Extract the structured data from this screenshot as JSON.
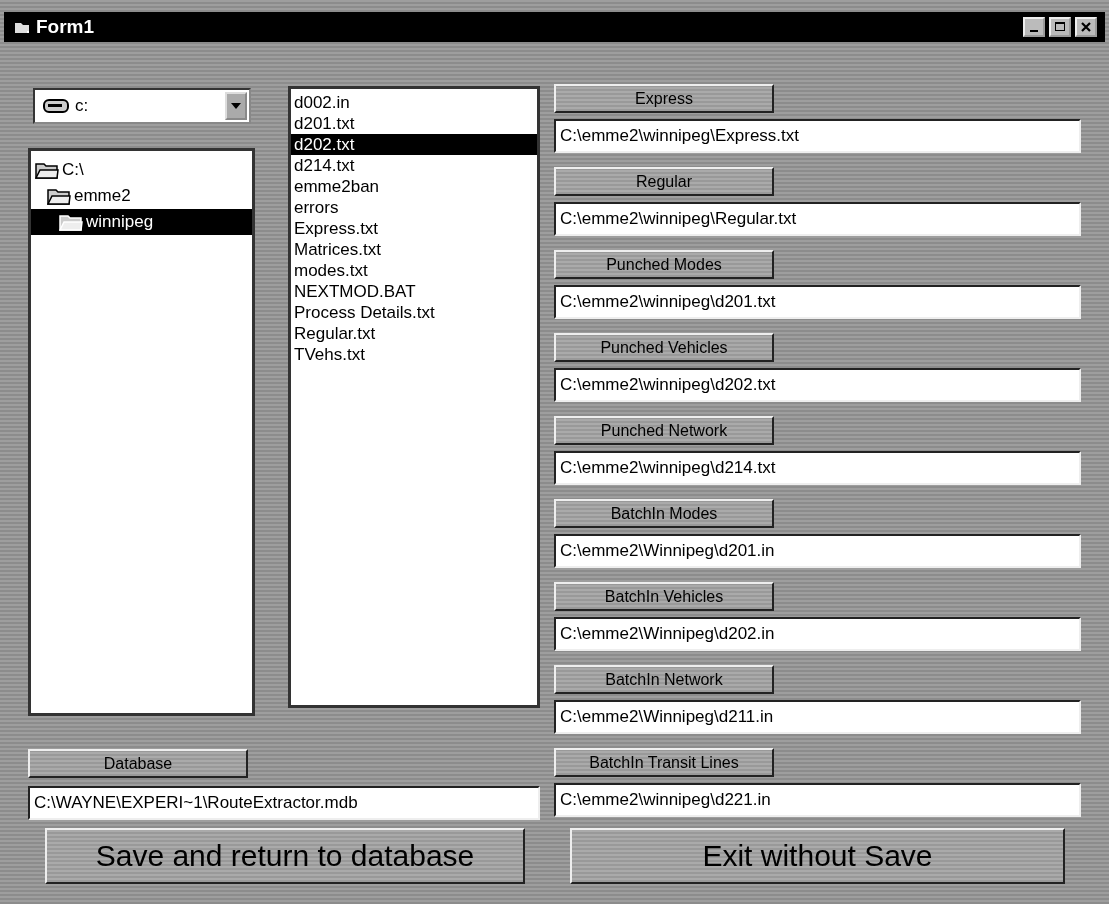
{
  "window": {
    "title": "Form1"
  },
  "drive_combo": {
    "value": "c:"
  },
  "folder_tree": [
    {
      "label": "C:\\",
      "selected": false,
      "children": [
        {
          "label": "emme2",
          "selected": false,
          "children": [
            {
              "label": "winnipeg",
              "selected": true
            }
          ]
        }
      ]
    }
  ],
  "file_list": [
    {
      "label": "d002.in",
      "selected": false
    },
    {
      "label": "d201.txt",
      "selected": false
    },
    {
      "label": "d202.txt",
      "selected": true
    },
    {
      "label": "d214.txt",
      "selected": false
    },
    {
      "label": "emme2ban",
      "selected": false
    },
    {
      "label": "errors",
      "selected": false
    },
    {
      "label": "Express.txt",
      "selected": false
    },
    {
      "label": "Matrices.txt",
      "selected": false
    },
    {
      "label": "modes.txt",
      "selected": false
    },
    {
      "label": "NEXTMOD.BAT",
      "selected": false
    },
    {
      "label": "Process Details.txt",
      "selected": false
    },
    {
      "label": "Regular.txt",
      "selected": false
    },
    {
      "label": "TVehs.txt",
      "selected": false
    }
  ],
  "database": {
    "button": "Database",
    "value": "C:\\WAYNE\\EXPERI~1\\RouteExtractor.mdb"
  },
  "file_slots": [
    {
      "button": "Express",
      "value": "C:\\emme2\\winnipeg\\Express.txt"
    },
    {
      "button": "Regular",
      "value": "C:\\emme2\\winnipeg\\Regular.txt"
    },
    {
      "button": "Punched Modes",
      "value": "C:\\emme2\\winnipeg\\d201.txt"
    },
    {
      "button": "Punched Vehicles",
      "value": "C:\\emme2\\winnipeg\\d202.txt"
    },
    {
      "button": "Punched Network",
      "value": "C:\\emme2\\winnipeg\\d214.txt"
    },
    {
      "button": "BatchIn Modes",
      "value": "C:\\emme2\\Winnipeg\\d201.in"
    },
    {
      "button": "BatchIn Vehicles",
      "value": "C:\\emme2\\Winnipeg\\d202.in"
    },
    {
      "button": "BatchIn Network",
      "value": "C:\\emme2\\Winnipeg\\d211.in"
    },
    {
      "button": "BatchIn Transit Lines",
      "value": "C:\\emme2\\winnipeg\\d221.in"
    }
  ],
  "buttons": [
    "Save and return to database",
    "Exit without Save"
  ]
}
